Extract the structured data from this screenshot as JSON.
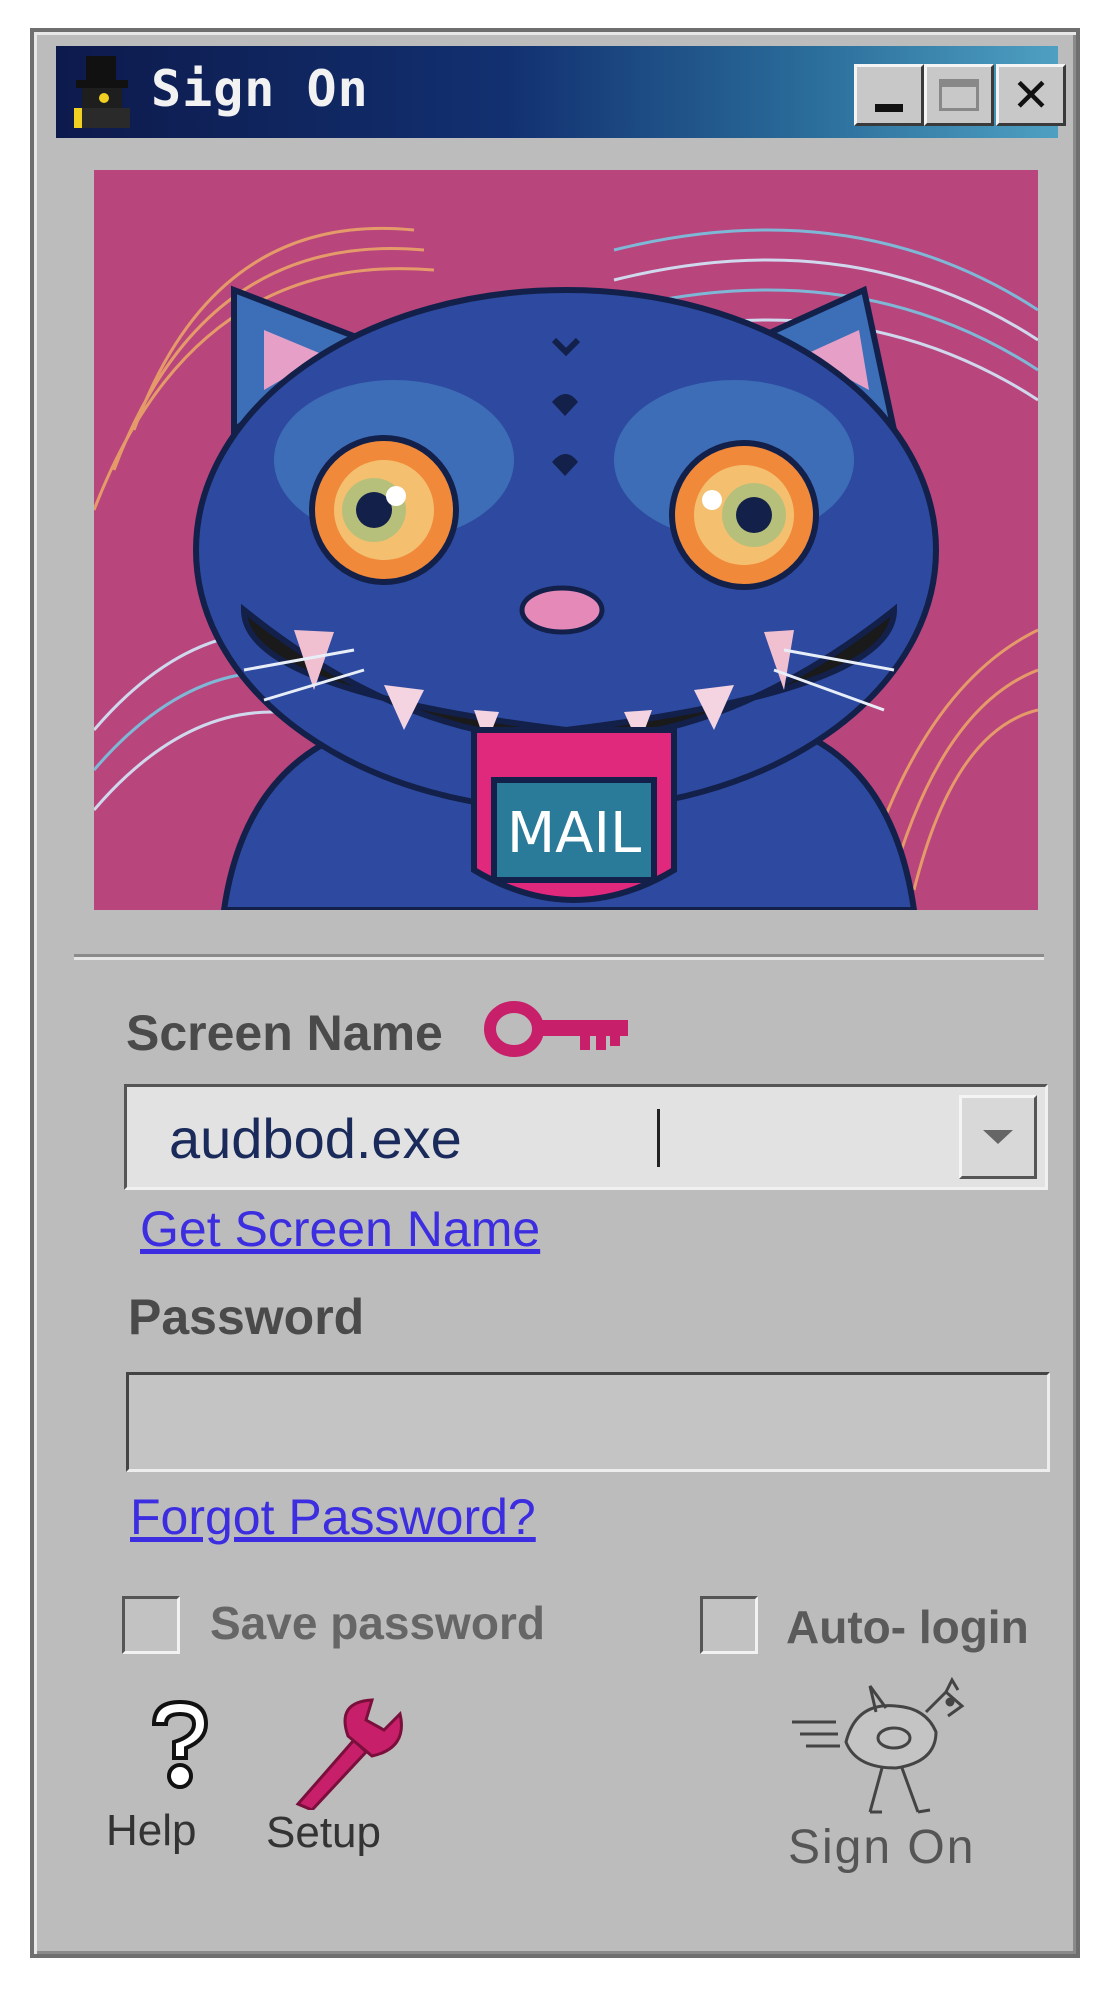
{
  "window": {
    "title": "Sign On",
    "minimize_label": "",
    "close_label": "✕"
  },
  "banner": {
    "mail_text": "MAIL",
    "background_color": "#b8457c",
    "creature_color": "#2d4aa0"
  },
  "screen_name": {
    "label": "Screen Name",
    "value": "audbod.exe",
    "get_link": "Get Screen Name"
  },
  "password": {
    "label": "Password",
    "value": "",
    "forgot_link": "Forgot Password?"
  },
  "options": {
    "save_password": {
      "label": "Save password",
      "checked": false
    },
    "auto_login": {
      "label": "Auto- login",
      "checked": false
    }
  },
  "toolbar": {
    "help_label": "Help",
    "setup_label": "Setup",
    "sign_on_label": "Sign On"
  },
  "colors": {
    "link": "#3c2ee0",
    "accent_pink": "#c81f6a",
    "window_gray": "#bcbcbc"
  }
}
